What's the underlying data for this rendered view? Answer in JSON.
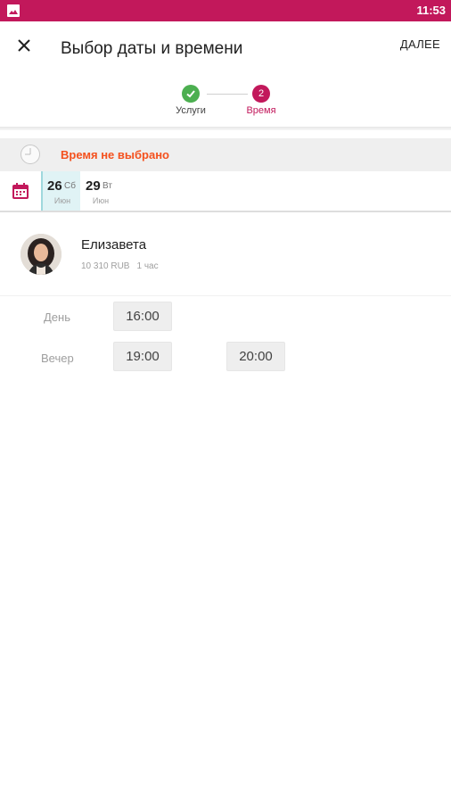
{
  "status_bar": {
    "time": "11:53",
    "icon": "image-icon"
  },
  "app_bar": {
    "title": "Выбор даты и времени",
    "next_label": "ДАЛЕЕ",
    "close_icon": "close-icon"
  },
  "stepper": {
    "steps": [
      {
        "label": "Услуги",
        "status": "done",
        "marker": ""
      },
      {
        "label": "Время",
        "status": "active",
        "marker": "2"
      }
    ]
  },
  "time_banner": {
    "text": "Время не выбрано",
    "icon": "clock-icon"
  },
  "dates": [
    {
      "day": "26",
      "weekday": "Сб",
      "month": "Июн",
      "selected": true
    },
    {
      "day": "29",
      "weekday": "Вт",
      "month": "Июн",
      "selected": false
    }
  ],
  "staff": {
    "name": "Елизавета",
    "price": "10 310 RUB",
    "duration": "1 час"
  },
  "slot_groups": [
    {
      "label": "День",
      "times": [
        "16:00"
      ]
    },
    {
      "label": "Вечер",
      "times": [
        "19:00",
        "20:00"
      ]
    }
  ],
  "colors": {
    "primary": "#c2185b",
    "success": "#4caf50",
    "warning_text": "#f4511e",
    "selected_date_bg": "#e0f3f5"
  }
}
